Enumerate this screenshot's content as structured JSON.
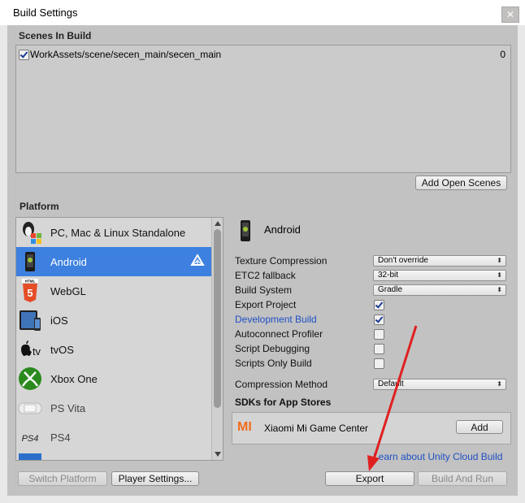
{
  "window": {
    "title": "Build Settings",
    "close_glyph": "✕"
  },
  "scenes": {
    "header": "Scenes In Build",
    "items": [
      {
        "path": "WorkAssets/scene/secen_main/secen_main",
        "index": "0",
        "checked": true
      }
    ],
    "add_open_scenes": "Add Open Scenes"
  },
  "platform": {
    "header": "Platform",
    "items": [
      {
        "label": "PC, Mac & Linux Standalone",
        "icon": "pc-mac-linux-icon"
      },
      {
        "label": "Android",
        "icon": "android-icon",
        "selected": true
      },
      {
        "label": "WebGL",
        "icon": "html5-icon"
      },
      {
        "label": "iOS",
        "icon": "ios-icon"
      },
      {
        "label": "tvOS",
        "icon": "apple-tv-icon"
      },
      {
        "label": "Xbox One",
        "icon": "xbox-icon"
      },
      {
        "label": "PS Vita",
        "icon": "ps-vita-icon"
      },
      {
        "label": "PS4",
        "icon": "ps4-icon"
      }
    ]
  },
  "settings": {
    "platform_title": "Android",
    "rows": {
      "texture_compression": {
        "label": "Texture Compression",
        "value": "Don't override"
      },
      "etc2_fallback": {
        "label": "ETC2 fallback",
        "value": "32-bit"
      },
      "build_system": {
        "label": "Build System",
        "value": "Gradle"
      },
      "export_project": {
        "label": "Export Project",
        "checked": true
      },
      "development_build": {
        "label": "Development Build",
        "checked": true
      },
      "autoconnect_profiler": {
        "label": "Autoconnect Profiler",
        "checked": false
      },
      "script_debugging": {
        "label": "Script Debugging",
        "checked": false
      },
      "scripts_only_build": {
        "label": "Scripts Only Build",
        "checked": false
      },
      "compression_method": {
        "label": "Compression Method",
        "value": "Default"
      }
    },
    "sdk_header": "SDKs for App Stores",
    "sdk_item": {
      "label": "Xiaomi Mi Game Center",
      "add_label": "Add",
      "icon_text": "MI"
    },
    "cloud_link": "Learn about Unity Cloud Build"
  },
  "footer": {
    "switch_platform": "Switch Platform",
    "player_settings": "Player Settings...",
    "export": "Export",
    "build_and_run": "Build And Run"
  },
  "colors": {
    "selection": "#3d80df",
    "link": "#1e4fc4",
    "annotation_arrow": "#e02020"
  }
}
